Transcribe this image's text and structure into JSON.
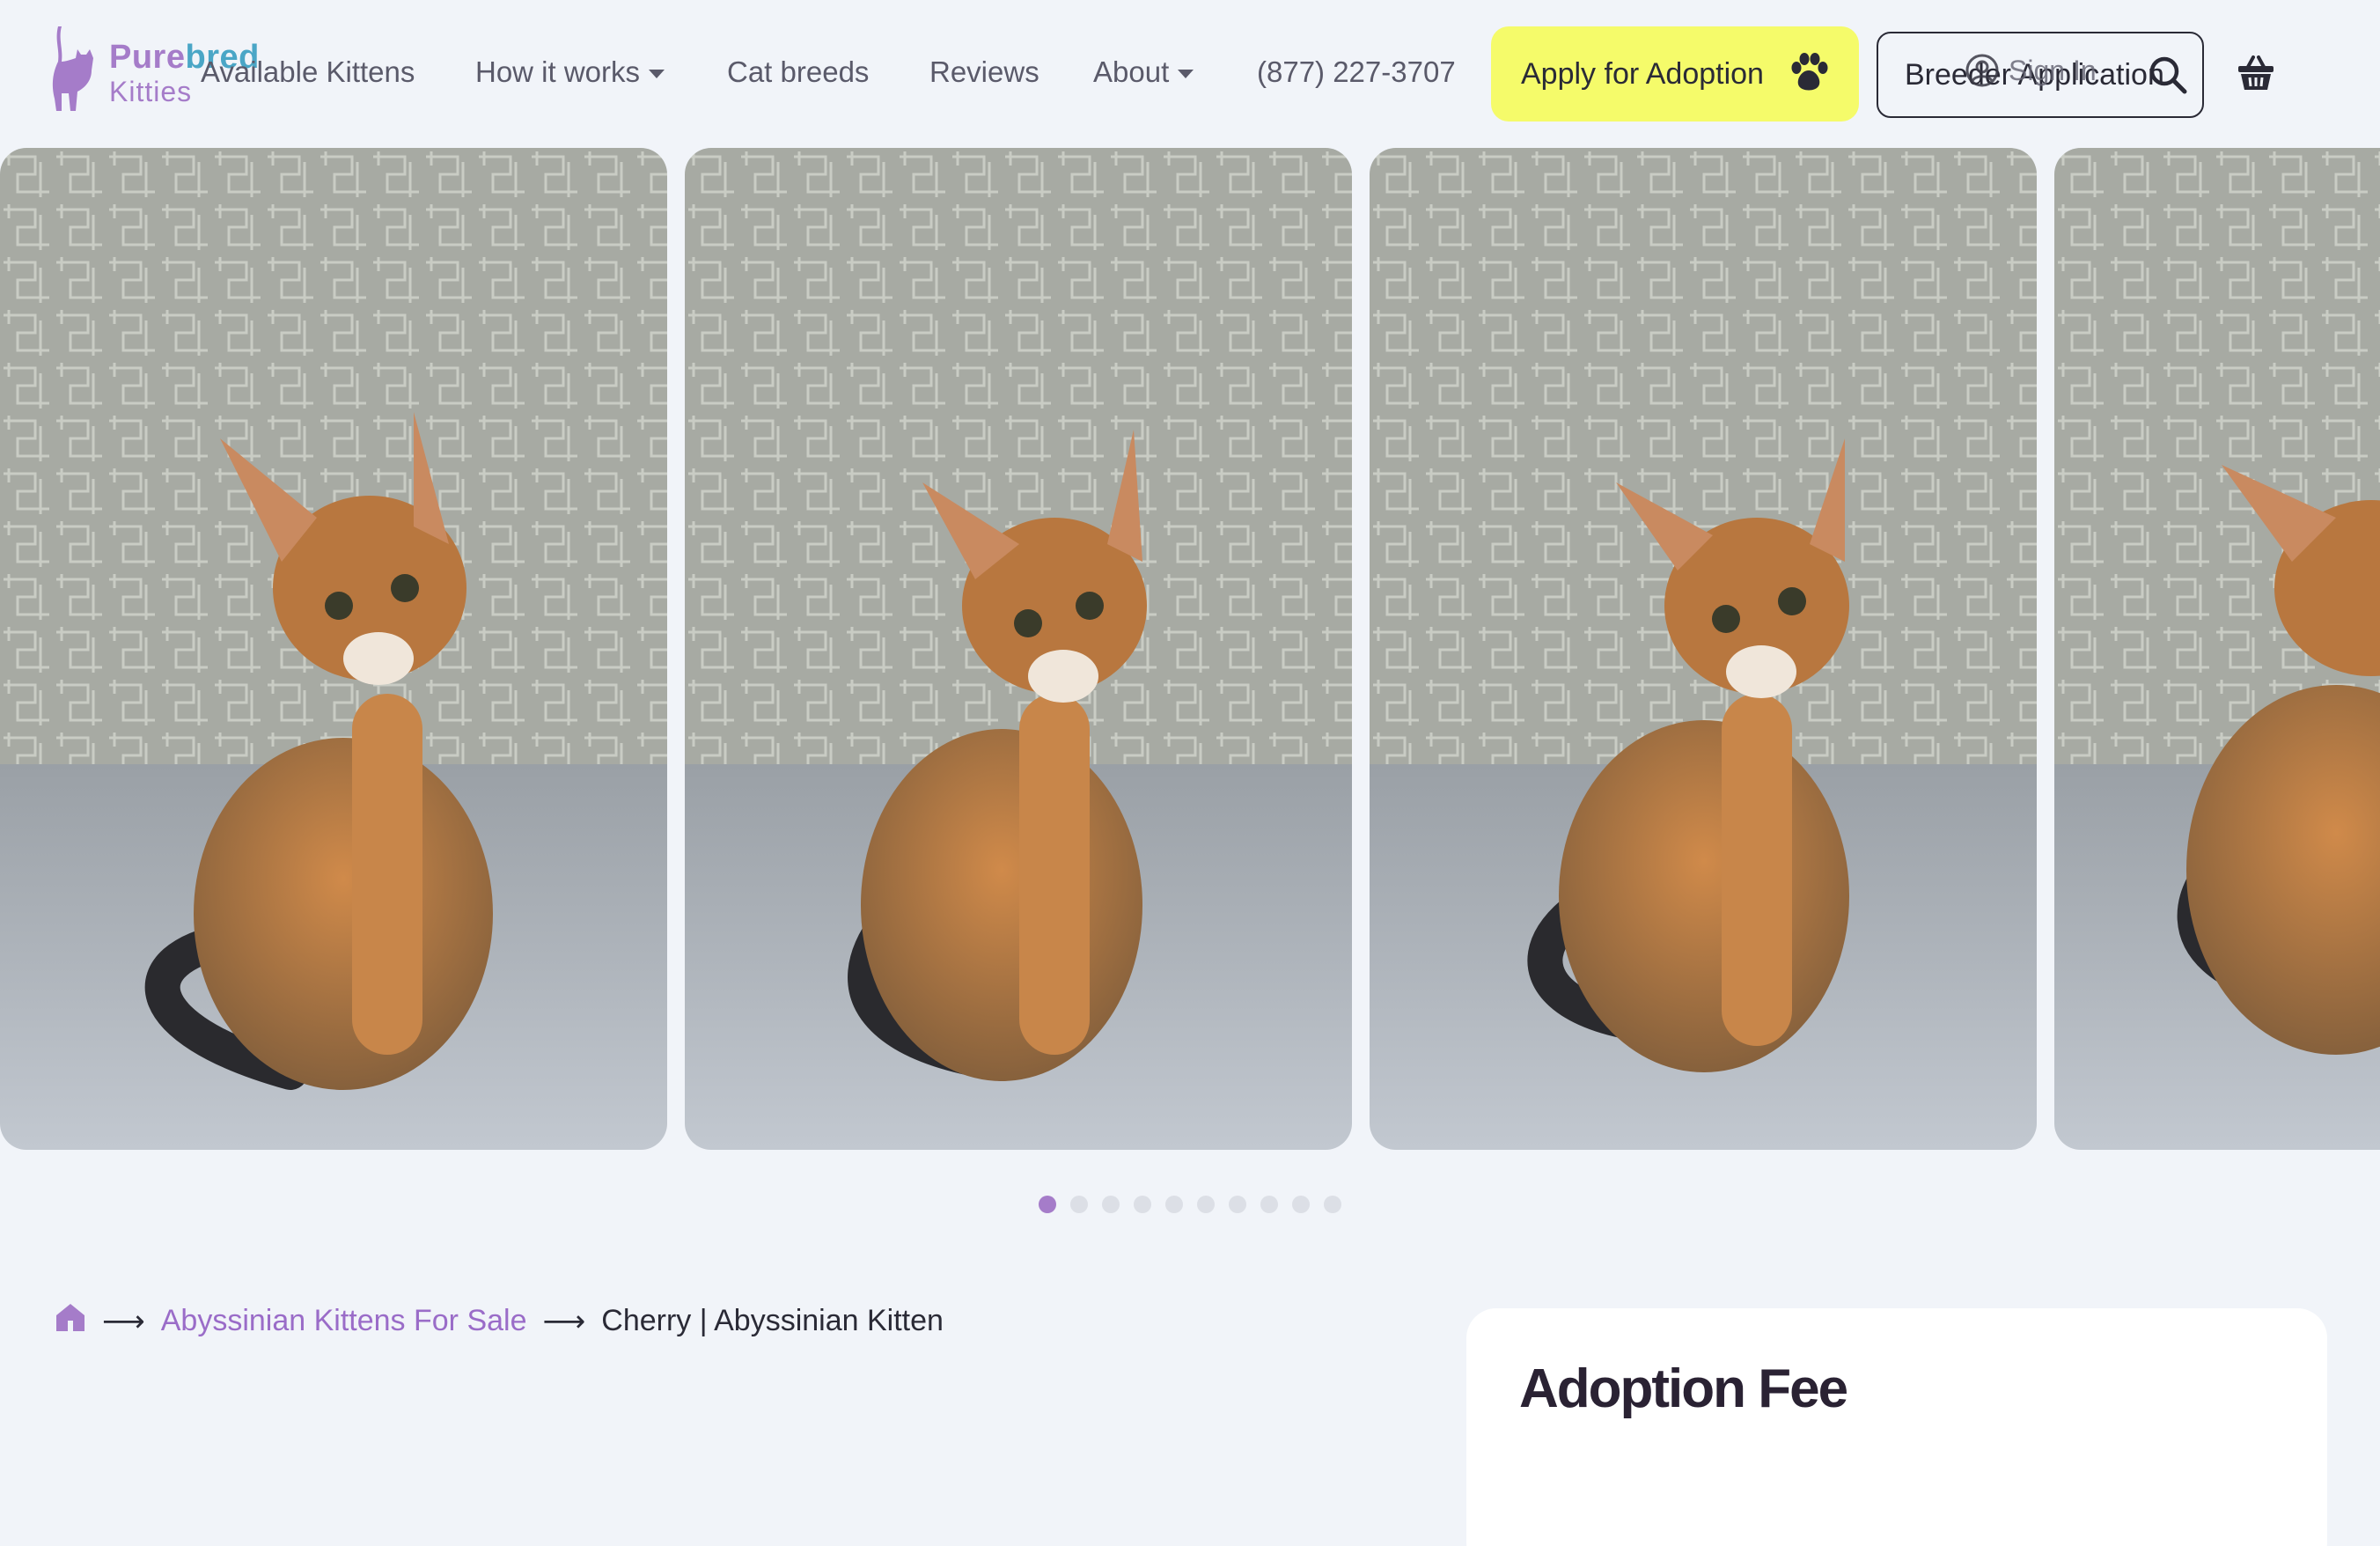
{
  "brand": {
    "name_part1": "Pure",
    "name_part2": "bred",
    "name_line2": "Kitties"
  },
  "nav": {
    "items": [
      {
        "label": "Available Kittens",
        "has_dropdown": false
      },
      {
        "label": "How it works",
        "has_dropdown": true
      },
      {
        "label": "Cat breeds",
        "has_dropdown": false
      },
      {
        "label": "Reviews",
        "has_dropdown": false
      },
      {
        "label": "About",
        "has_dropdown": true
      }
    ],
    "phone": "(877) 227-3707",
    "apply_button": "Apply for Adoption",
    "breeder_button": "Breeder Application",
    "sign_in": "Sign In"
  },
  "icons": {
    "apply": "paw-icon",
    "sign_in": "user-icon",
    "search": "search-icon",
    "cart": "basket-icon",
    "home": "home-icon"
  },
  "gallery": {
    "slide_count": 10,
    "active_index": 0,
    "slides": [
      {
        "alt": "Abyssinian kitten photo"
      },
      {
        "alt": "Abyssinian kitten photo"
      },
      {
        "alt": "Abyssinian kitten photo"
      },
      {
        "alt": "Abyssinian kitten photo"
      }
    ]
  },
  "breadcrumb": {
    "category": "Abyssinian Kittens For Sale",
    "current": "Cherry | Abyssinian Kitten"
  },
  "fee_card": {
    "title": "Adoption Fee"
  },
  "colors": {
    "page_bg": "#f1f4f9",
    "brand_purple": "#a57cc9",
    "brand_teal": "#4aa6c6",
    "apply_yellow": "#f5fb6a",
    "text_dark": "#2a2a36"
  }
}
